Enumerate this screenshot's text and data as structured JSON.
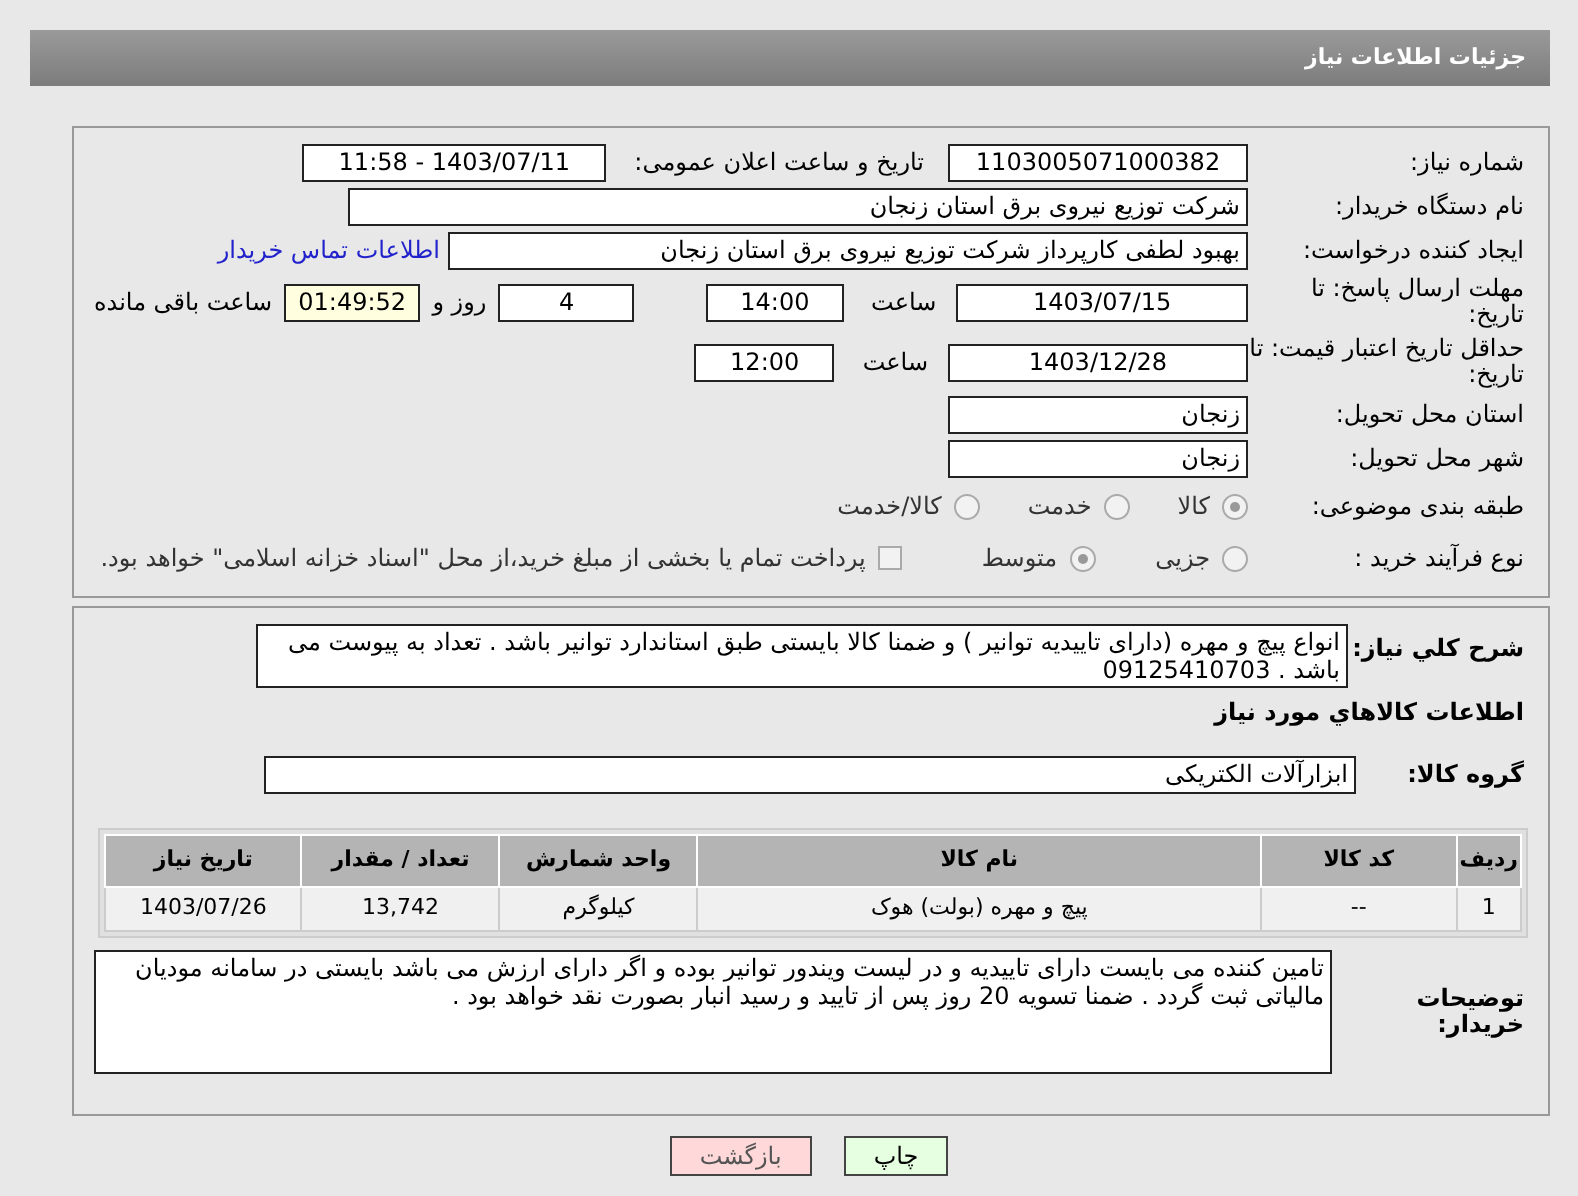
{
  "page_title": "جزئیات اطلاعات نیاز",
  "need_number": {
    "label": "شماره نیاز:",
    "value": "1103005071000382"
  },
  "announce": {
    "label": "تاریخ و ساعت اعلان عمومی:",
    "value": "1403/07/11 - 11:58"
  },
  "buyer_org": {
    "label": "نام دستگاه خریدار:",
    "value": "شرکت توزیع نیروی برق استان زنجان"
  },
  "requester": {
    "label": "ایجاد کننده درخواست:",
    "value": "بهبود لطفی کارپرداز شرکت توزیع نیروی برق استان زنجان",
    "contact_link": "اطلاعات تماس خریدار"
  },
  "reply_deadline": {
    "label": "مهلت ارسال پاسخ: تا تاریخ:",
    "date": "1403/07/15",
    "time_label": "ساعت",
    "time": "14:00",
    "days": "4",
    "days_label": "روز و",
    "remaining": "01:49:52",
    "remaining_label": "ساعت باقی مانده"
  },
  "price_validity": {
    "label": "حداقل تاریخ اعتبار قیمت: تا تاریخ:",
    "date": "1403/12/28",
    "time_label": "ساعت",
    "time": "12:00"
  },
  "province": {
    "label": "استان محل تحویل:",
    "value": "زنجان"
  },
  "city": {
    "label": "شهر محل تحویل:",
    "value": "زنجان"
  },
  "category": {
    "label": "طبقه بندی موضوعی:",
    "options": [
      {
        "label": "کالا",
        "selected": true
      },
      {
        "label": "خدمت",
        "selected": false
      },
      {
        "label": "کالا/خدمت",
        "selected": false
      }
    ]
  },
  "process": {
    "label": "نوع فرآیند خرید :",
    "options": [
      {
        "label": "جزیی",
        "selected": false
      },
      {
        "label": "متوسط",
        "selected": true
      }
    ],
    "treasury": {
      "checked": false,
      "label": "پرداخت تمام یا بخشی از مبلغ خرید،از محل \"اسناد خزانه اسلامی\" خواهد بود."
    }
  },
  "description": {
    "label": "شرح کلي نياز:",
    "value": "انواع پیچ و مهره (دارای تاییدیه توانیر ) و ضمنا کالا بایستی طبق استاندارد توانیر باشد . تعداد به پیوست می باشد . 09125410703"
  },
  "goods_heading": "اطلاعات کالاهاي مورد نياز",
  "goods_group": {
    "label": "گروه کالا:",
    "value": "ابزارآلات الکتریکی"
  },
  "table": {
    "columns": [
      "ردیف",
      "کد کالا",
      "نام کالا",
      "واحد شمارش",
      "تعداد / مقدار",
      "تاریخ نیاز"
    ],
    "rows": [
      [
        "1",
        "--",
        "پیچ و مهره (بولت) هوک",
        "کیلوگرم",
        "13,742",
        "1403/07/26"
      ]
    ]
  },
  "buyer_notes": {
    "label": "توضیحات خریدار:",
    "value": "تامین کننده می بایست دارای تاییدیه و در لیست ویندور توانیر بوده و اگر دارای ارزش می باشد بایستی در سامانه مودیان مالیاتی ثبت گردد . ضمنا تسویه 20 روز پس از تایید و رسید انبار بصورت نقد خواهد بود ."
  },
  "buttons": [
    {
      "label": "چاپ",
      "kind": "print"
    },
    {
      "label": "بازگشت",
      "kind": "back"
    }
  ]
}
